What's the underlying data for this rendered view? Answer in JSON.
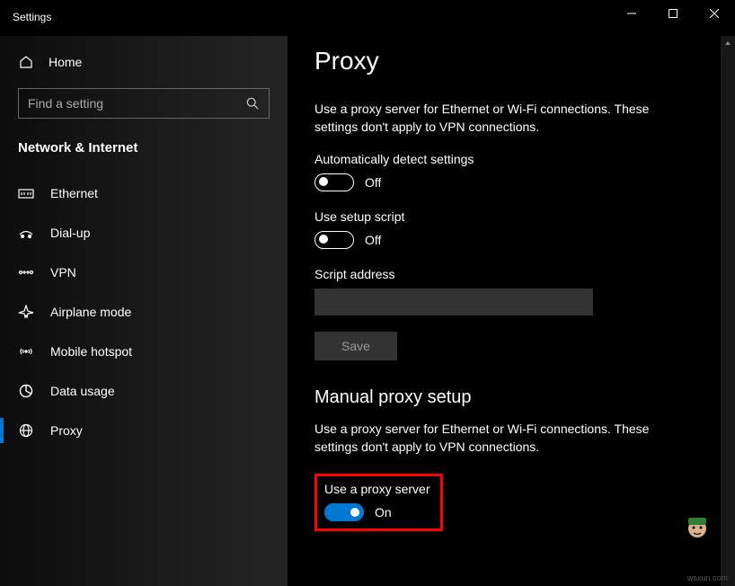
{
  "window": {
    "title": "Settings"
  },
  "sidebar": {
    "home_label": "Home",
    "search_placeholder": "Find a setting",
    "category": "Network & Internet",
    "items": [
      {
        "label": "Ethernet"
      },
      {
        "label": "Dial-up"
      },
      {
        "label": "VPN"
      },
      {
        "label": "Airplane mode"
      },
      {
        "label": "Mobile hotspot"
      },
      {
        "label": "Data usage"
      },
      {
        "label": "Proxy"
      }
    ]
  },
  "content": {
    "page_title": "Proxy",
    "auto_section": {
      "desc": "Use a proxy server for Ethernet or Wi-Fi connections. These settings don't apply to VPN connections.",
      "auto_detect_label": "Automatically detect settings",
      "auto_detect_state": "Off",
      "use_script_label": "Use setup script",
      "use_script_state": "Off",
      "script_address_label": "Script address",
      "script_address_value": "",
      "save_label": "Save"
    },
    "manual_section": {
      "heading": "Manual proxy setup",
      "desc": "Use a proxy server for Ethernet or Wi-Fi connections. These settings don't apply to VPN connections.",
      "use_proxy_label": "Use a proxy server",
      "use_proxy_state": "On"
    }
  },
  "watermark": "wsxun.com"
}
